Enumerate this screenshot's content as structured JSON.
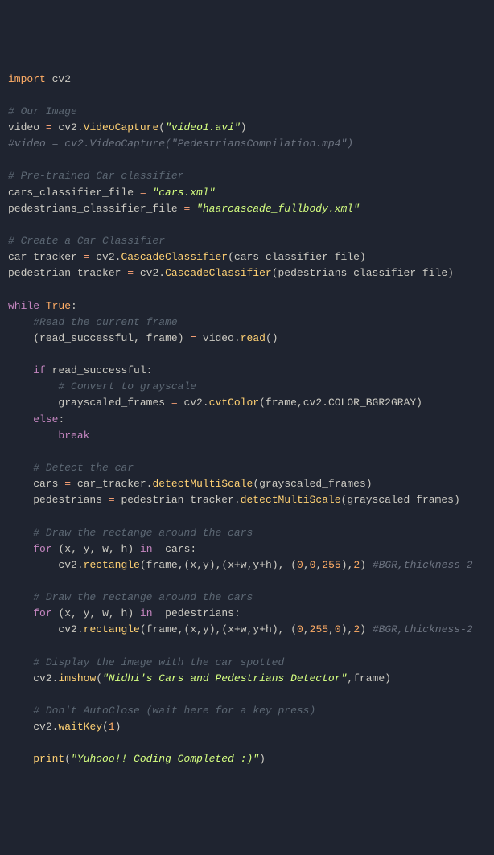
{
  "lines": {
    "l1_kw": "import",
    "l1_mod": "cv2",
    "l3_cmt": "# Our Image",
    "l4_var": "video",
    "l4_eq": " = ",
    "l4_obj": "cv2",
    "l4_dot": ".",
    "l4_fn": "VideoCapture",
    "l4_str": "\"video1.avi\"",
    "l5_cmt": "#video = cv2.VideoCapture(\"PedestriansCompilation.mp4\")",
    "l7_cmt": "# Pre-trained Car classifier",
    "l8_var": "cars_classifier_file",
    "l8_str": "\"cars.xml\"",
    "l9_var": "pedestrians_classifier_file",
    "l9_str": "\"haarcascade_fullbody.xml\"",
    "l11_cmt": "# Create a Car Classifier",
    "l12_var": "car_tracker",
    "l12_fn": "CascadeClassifier",
    "l12_arg": "cars_classifier_file",
    "l13_var": "pedestrian_tracker",
    "l13_arg": "pedestrians_classifier_file",
    "l15_while": "while",
    "l15_true": "True",
    "l16_cmt": "#Read the current frame",
    "l17_v1": "read_successful",
    "l17_v2": "frame",
    "l17_v3": "video",
    "l17_fn": "read",
    "l19_if": "if",
    "l19_cond": "read_successful",
    "l20_cmt": "# Convert to grayscale",
    "l21_var": "grayscaled_frames",
    "l21_fn": "cvtColor",
    "l21_a1": "frame",
    "l21_a2": "cv2",
    "l21_a3": "COLOR_BGR2GRAY",
    "l22_else": "else",
    "l23_break": "break",
    "l25_cmt": "# Detect the car",
    "l26_var": "cars",
    "l26_obj": "car_tracker",
    "l26_fn": "detectMultiScale",
    "l26_arg": "grayscaled_frames",
    "l27_var": "pedestrians",
    "l27_obj": "pedestrian_tracker",
    "l29_cmt": "# Draw the rectange around the cars",
    "l30_for": "for",
    "l30_x": "x",
    "l30_y": "y",
    "l30_w": "w",
    "l30_h": "h",
    "l30_in": "in",
    "l30_iter": "cars",
    "l31_fn": "rectangle",
    "l31_a1": "frame",
    "l31_xw": "x+w",
    "l31_yh": "y+h",
    "l31_n0": "0",
    "l31_n255": "255",
    "l31_n2": "2",
    "l31_cmt": "#BGR,thickness-2",
    "l33_cmt": "# Draw the rectange around the cars",
    "l34_iter": "pedestrians",
    "l37_cmt": "# Display the image with the car spotted",
    "l38_fn": "imshow",
    "l38_str": "\"Nidhi's Cars and Pedestrians Detector\"",
    "l38_arg": "frame",
    "l40_cmt": "# Don't AutoClose (wait here for a key press)",
    "l41_fn": "waitKey",
    "l41_n": "1",
    "l43_fn": "print",
    "l43_str": "\"Yuhooo!! Coding Completed :)\""
  }
}
